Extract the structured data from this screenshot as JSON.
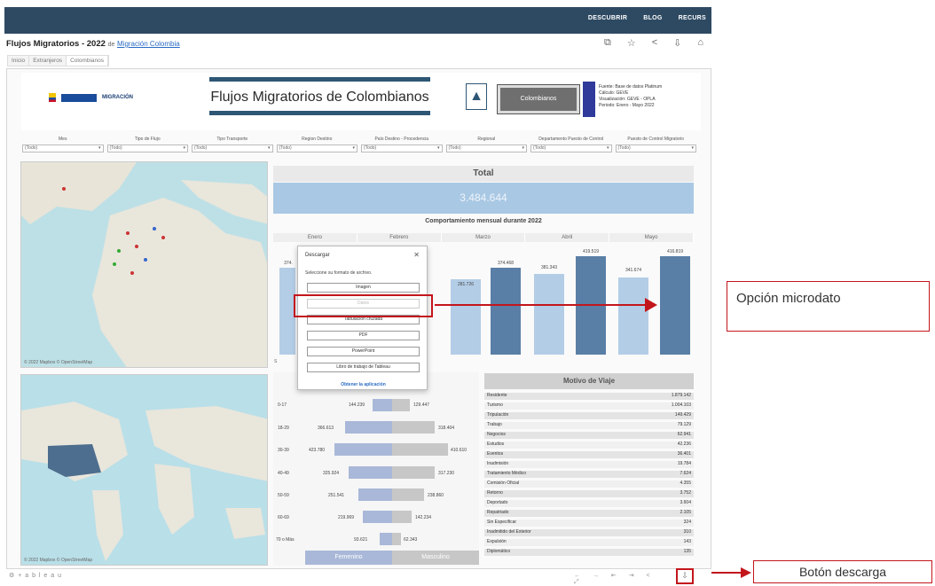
{
  "topnav": [
    "DESCUBRIR",
    "BLOG",
    "RECURS"
  ],
  "page": {
    "title": "Flujos Migratorios - 2022",
    "by": "de",
    "author": "Migración Colombia",
    "tabs": [
      "Inicio",
      "Extranjeros",
      "Colombianos"
    ]
  },
  "action_icons": [
    "⧉",
    "☆",
    "<",
    "⇩",
    "⌂"
  ],
  "header": {
    "logo_text": "MIGRACIÓN",
    "title": "Flujos Migratorios de Colombianos",
    "button": "Colombianos",
    "source_lines": [
      "Fuente: Base de datos Platinum",
      "Cálculo: GEVE",
      "Visualización: GEVE - OPLA",
      "Periodo: Enero - Mayo 2022"
    ]
  },
  "filters": [
    {
      "label": "Mes",
      "value": "(Todo)"
    },
    {
      "label": "Tipo de Flujo",
      "value": "(Todo)"
    },
    {
      "label": "Tipo Transporte",
      "value": "(Todo)"
    },
    {
      "label": "Region Destino",
      "value": "(Todo)"
    },
    {
      "label": "País Destino - Procedencia",
      "value": "(Todo)"
    },
    {
      "label": "Regional",
      "value": "(Todo)"
    },
    {
      "label": "Departamento Puesto de Control",
      "value": "(Todo)"
    },
    {
      "label": "Puesto de Control Migratorio",
      "value": "(Todo)"
    }
  ],
  "map_copyright": "© 2022 Mapbox © OpenStreetMap",
  "total": {
    "label": "Total",
    "value": "3.484.644"
  },
  "monthly": {
    "title": "Comportamiento mensual durante 2022",
    "months": [
      "Enero",
      "Febrero",
      "Marzo",
      "Abril",
      "Mayo"
    ],
    "bar_labels": [
      "374.",
      "",
      "",
      "",
      "",
      "281.726",
      "374.468",
      "381.343",
      "419.519",
      "341.674",
      "416.819"
    ],
    "legend": "S"
  },
  "age": {
    "groups": [
      "0-17",
      "18-29",
      "30-39",
      "40-49",
      "50-59",
      "60-69",
      "70 o Más"
    ],
    "female": [
      "144.239",
      "366.613",
      "423.780",
      "325.924",
      "251.541",
      "219.969",
      "93.621"
    ],
    "male": [
      "129.447",
      "318.404",
      "410.610",
      "317.230",
      "238.860",
      "142.234",
      "62.343"
    ],
    "female_label": "Femenino",
    "male_label": "Masculino"
  },
  "motives": {
    "title": "Motivo de Viaje",
    "rows": [
      {
        "name": "Residente",
        "value": "1.879.142"
      },
      {
        "name": "Turismo",
        "value": "1.004.103"
      },
      {
        "name": "Tripulación",
        "value": "149.429"
      },
      {
        "name": "Trabajo",
        "value": "79.129"
      },
      {
        "name": "Negocios",
        "value": "62.941"
      },
      {
        "name": "Estudios",
        "value": "42.236"
      },
      {
        "name": "Eventos",
        "value": "36.401"
      },
      {
        "name": "Inadmisión",
        "value": "19.784"
      },
      {
        "name": "Tratamiento Médico",
        "value": "7.624"
      },
      {
        "name": "Comisión Oficial",
        "value": "4.355"
      },
      {
        "name": "Retorno",
        "value": "3.752"
      },
      {
        "name": "Deportado",
        "value": "3.604"
      },
      {
        "name": "Repatriado",
        "value": "2.105"
      },
      {
        "name": "Sin Especificar",
        "value": "324"
      },
      {
        "name": "Inadmitido del Exterior",
        "value": "310"
      },
      {
        "name": "Expulsión",
        "value": "143"
      },
      {
        "name": "Diplomático",
        "value": "135"
      }
    ]
  },
  "dialog": {
    "title": "Descargar",
    "close": "✕",
    "subtitle": "Seleccione su formato de archivo.",
    "buttons": [
      "Imagen",
      "Datos",
      "Tabulación cruzada",
      "PDF",
      "PowerPoint",
      "Libro de trabajo de Tableau"
    ],
    "link": "Obtener la aplicación"
  },
  "callouts": {
    "microdato": "Opción microdato",
    "download": "Botón descarga"
  },
  "bottom": {
    "tableau": "⚙ + a b l e a u",
    "nav": "←  →  ⇤  ⇥  <  ⤢",
    "download_icon": "⇩"
  },
  "colors": {
    "accent_red": "#c3161c",
    "topbar": "#2e4a63",
    "bar_light": "#b3cde6",
    "bar_dark": "#5a7fa6"
  }
}
